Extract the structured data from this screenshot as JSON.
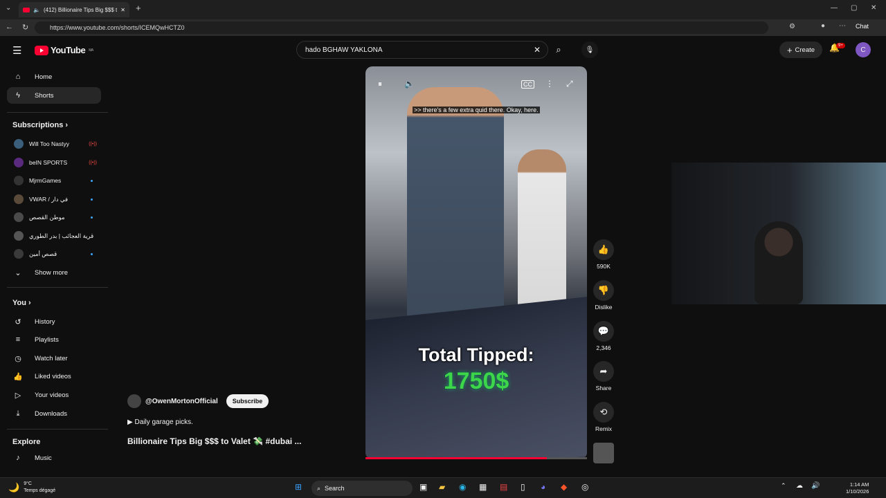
{
  "browser": {
    "tab_title": "(412) Billionaire Tips Big $$$ t",
    "url": "https://www.youtube.com/shorts/ICEMQwHCTZ0",
    "chat_label": "Chat"
  },
  "header": {
    "logo_text": "YouTube",
    "logo_region": "MA",
    "search_value": "hado BGHAW YAKLONA",
    "create_label": "Create",
    "notif_count": "9+",
    "avatar_letter": "C"
  },
  "sidebar": {
    "main": [
      {
        "label": "Home",
        "icon": "home-icon"
      },
      {
        "label": "Shorts",
        "icon": "shorts-icon"
      }
    ],
    "subscriptions_title": "Subscriptions",
    "subscriptions": [
      {
        "label": "Will Too Nastyy",
        "status": "live"
      },
      {
        "label": "beIN SPORTS",
        "status": "live"
      },
      {
        "label": "MjrmGames",
        "status": "new"
      },
      {
        "label": "VWAR / في دار",
        "status": "new"
      },
      {
        "label": "موطن القصص",
        "status": "new"
      },
      {
        "label": "قرية العجائب | بدر الطوري",
        "status": ""
      },
      {
        "label": "قصص أمين",
        "status": "new"
      }
    ],
    "show_more": "Show more",
    "you_title": "You",
    "you_items": [
      {
        "label": "History",
        "icon": "history-icon"
      },
      {
        "label": "Playlists",
        "icon": "playlists-icon"
      },
      {
        "label": "Watch later",
        "icon": "watch-later-icon"
      },
      {
        "label": "Liked videos",
        "icon": "liked-icon"
      },
      {
        "label": "Your videos",
        "icon": "your-videos-icon"
      },
      {
        "label": "Downloads",
        "icon": "download-icon"
      }
    ],
    "explore_title": "Explore",
    "explore_items": [
      {
        "label": "Music",
        "icon": "music-icon"
      }
    ]
  },
  "video": {
    "caption": ">> there's a few extra quid there. Okay, here.",
    "overlay_label": "Total Tipped:",
    "overlay_value": "1750$",
    "progress": 0.82
  },
  "actions": {
    "likes": "590K",
    "dislike": "Dislike",
    "comments": "2,346",
    "share": "Share",
    "remix": "Remix"
  },
  "meta": {
    "channel": "@OwenMortonOfficial",
    "subscribe": "Subscribe",
    "description": "Daily garage picks.",
    "title": "Billionaire Tips Big $$$ to Valet 💸 #dubai ..."
  },
  "taskbar": {
    "temp": "9°C",
    "weather": "Temps dégagé",
    "search": "Search",
    "time": "1:14 AM",
    "date": "1/10/2026"
  }
}
